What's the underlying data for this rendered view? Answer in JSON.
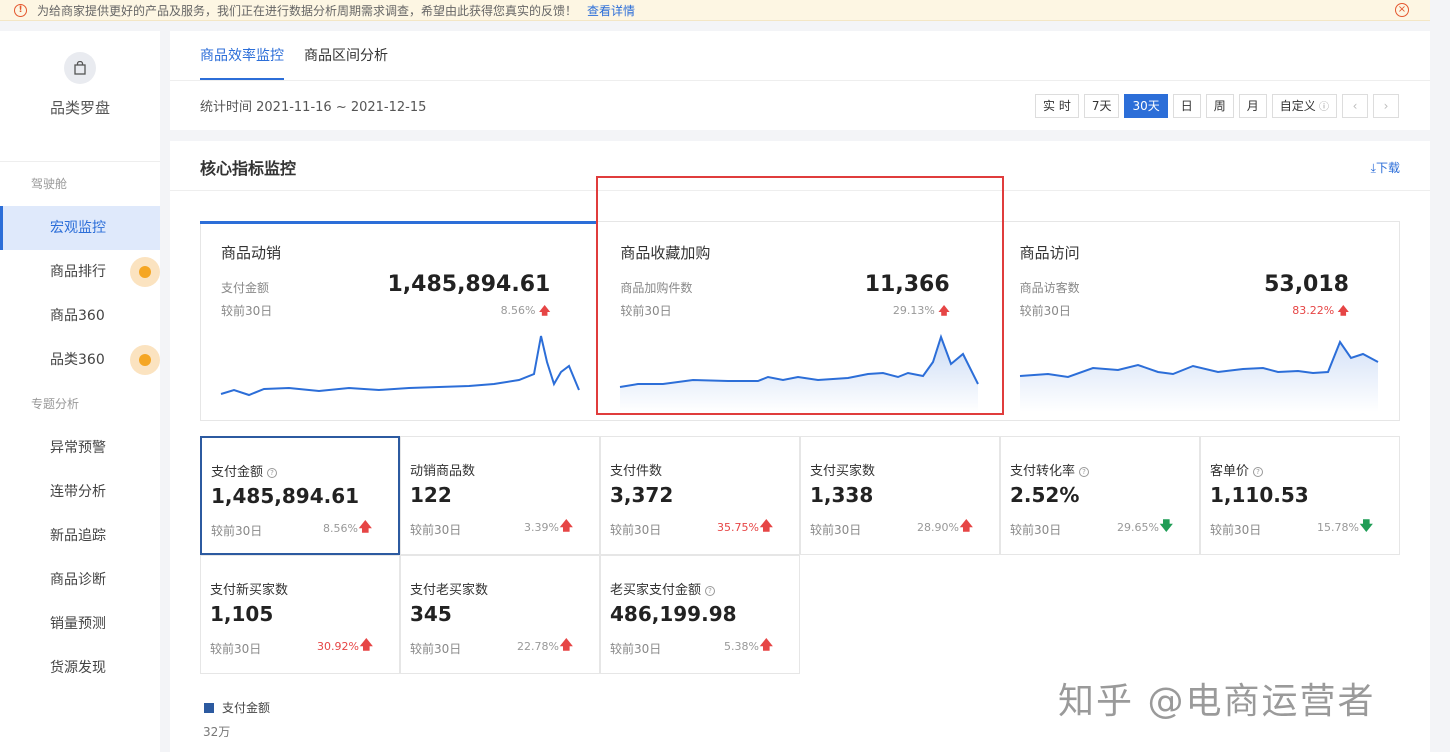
{
  "notice": {
    "text": "为给商家提供更好的产品及服务，我们正在进行数据分析周期需求调查，希望由此获得您真实的反馈！",
    "link": "查看详情"
  },
  "sidebar": {
    "brand": "品类罗盘",
    "section1": "驾驶舱",
    "items1": [
      "宏观监控",
      "商品排行",
      "商品360",
      "品类360"
    ],
    "section2": "专题分析",
    "items2": [
      "异常预警",
      "连带分析",
      "新品追踪",
      "商品诊断",
      "销量预测",
      "货源发现"
    ]
  },
  "tabs": [
    "商品效率监控",
    "商品区间分析"
  ],
  "date_range": "统计时间 2021-11-16 ~ 2021-12-15",
  "period_buttons": [
    "实 时",
    "7天",
    "30天",
    "日",
    "周",
    "月",
    "自定义"
  ],
  "main": {
    "title": "核心指标监控",
    "download": "下载"
  },
  "top_cards": [
    {
      "title": "商品动销",
      "label": "支付金额",
      "value": "1,485,894.61",
      "compare": "较前30日",
      "pct": "8.56%",
      "pct_color": "grey"
    },
    {
      "title": "商品收藏加购",
      "label": "商品加购件数",
      "value": "11,366",
      "compare": "较前30日",
      "pct": "29.13%",
      "pct_color": "grey"
    },
    {
      "title": "商品访问",
      "label": "商品访客数",
      "value": "53,018",
      "compare": "较前30日",
      "pct": "83.22%",
      "pct_color": "red"
    }
  ],
  "metrics": [
    {
      "name": "支付金额",
      "help": true,
      "value": "1,485,894.61",
      "compare": "较前30日",
      "pct": "8.56%",
      "red": false,
      "trend": "up"
    },
    {
      "name": "动销商品数",
      "help": false,
      "value": "122",
      "compare": "较前30日",
      "pct": "3.39%",
      "red": false,
      "trend": "up"
    },
    {
      "name": "支付件数",
      "help": false,
      "value": "3,372",
      "compare": "较前30日",
      "pct": "35.75%",
      "red": true,
      "trend": "up"
    },
    {
      "name": "支付买家数",
      "help": false,
      "value": "1,338",
      "compare": "较前30日",
      "pct": "28.90%",
      "red": false,
      "trend": "up"
    },
    {
      "name": "支付转化率",
      "help": true,
      "value": "2.52%",
      "compare": "较前30日",
      "pct": "29.65%",
      "red": false,
      "trend": "down"
    },
    {
      "name": "客单价",
      "help": true,
      "value": "1,110.53",
      "compare": "较前30日",
      "pct": "15.78%",
      "red": false,
      "trend": "down"
    },
    {
      "name": "支付新买家数",
      "help": false,
      "value": "1,105",
      "compare": "较前30日",
      "pct": "30.92%",
      "red": true,
      "trend": "up"
    },
    {
      "name": "支付老买家数",
      "help": false,
      "value": "345",
      "compare": "较前30日",
      "pct": "22.78%",
      "red": false,
      "trend": "up"
    },
    {
      "name": "老买家支付金额",
      "help": true,
      "value": "486,199.98",
      "compare": "较前30日",
      "pct": "5.38%",
      "red": false,
      "trend": "up"
    }
  ],
  "chart": {
    "legend": "支付金额",
    "ytick": "32万"
  },
  "watermark": "知乎 @电商运营者",
  "colors": {
    "accent": "#2c6ed8",
    "up": "#e64545",
    "down": "#1f9d55",
    "highlight_box": "#e03c3c"
  }
}
